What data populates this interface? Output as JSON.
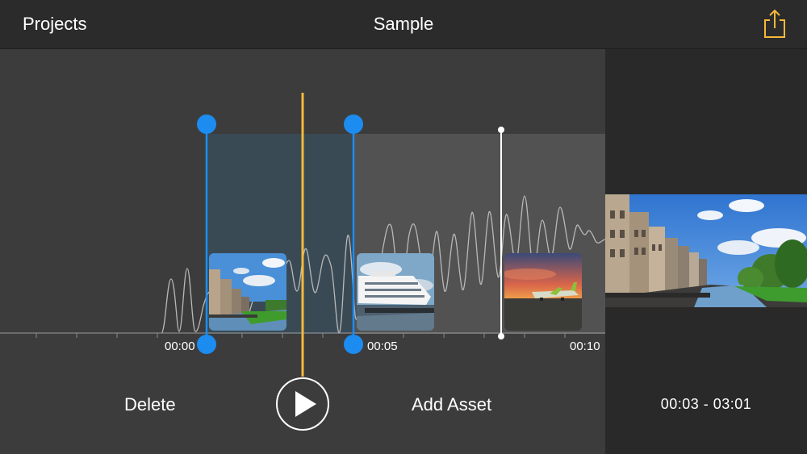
{
  "navbar": {
    "back_label": "Projects",
    "title": "Sample",
    "share_icon": "share-icon",
    "accent": "#f5b93a"
  },
  "timeline": {
    "tick_labels": [
      "00:00",
      "00:05",
      "00:10"
    ],
    "clips": [
      {
        "name": "canal-street-clip",
        "scene": "city canal"
      },
      {
        "name": "cruise-ship-clip",
        "scene": "cruise ship"
      },
      {
        "name": "sunset-airplane-clip",
        "scene": "airplane at sunset"
      }
    ],
    "selection_color": "#1c8cf0",
    "playhead_color": "#f5b93a"
  },
  "controls": {
    "delete_label": "Delete",
    "play_icon": "play-icon",
    "add_asset_label": "Add Asset"
  },
  "preview": {
    "range_label": "00:03 - 03:01"
  }
}
